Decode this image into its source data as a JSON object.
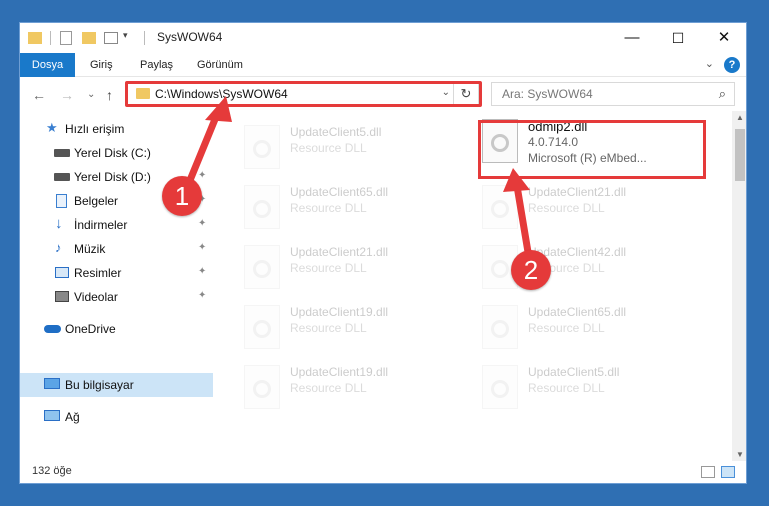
{
  "window": {
    "title": "SysWOW64",
    "controls": {
      "minimize": "—",
      "maximize": "☐",
      "close": "✕"
    }
  },
  "ribbon": {
    "tabs": [
      "Dosya",
      "Giriş",
      "Paylaş",
      "Görünüm"
    ],
    "help": "?",
    "collapse": "⌄"
  },
  "nav": {
    "back": "←",
    "forward": "→",
    "recent": "⌄",
    "up": "↑",
    "address": "C:\\Windows\\SysWOW64",
    "search_placeholder": "Ara: SysWOW64",
    "refresh": "↻"
  },
  "sidebar": {
    "items": [
      {
        "label": "Hızlı erişim",
        "icon": "star-icon",
        "pinned": false
      },
      {
        "label": "Yerel Disk (C:)",
        "icon": "drive-icon",
        "pinned": false
      },
      {
        "label": "Yerel Disk (D:)",
        "icon": "drive-icon",
        "pinned": true
      },
      {
        "label": "Belgeler",
        "icon": "documents-icon",
        "pinned": true
      },
      {
        "label": "İndirmeler",
        "icon": "download-icon",
        "pinned": true
      },
      {
        "label": "Müzik",
        "icon": "music-icon",
        "pinned": true
      },
      {
        "label": "Resimler",
        "icon": "pictures-icon",
        "pinned": true
      },
      {
        "label": "Videolar",
        "icon": "videos-icon",
        "pinned": true
      },
      {
        "label": "OneDrive",
        "icon": "cloud-icon",
        "pinned": false
      },
      {
        "label": "Bu bilgisayar",
        "icon": "computer-icon",
        "pinned": false,
        "selected": true
      },
      {
        "label": "Ağ",
        "icon": "network-icon",
        "pinned": false
      }
    ],
    "pin_glyph": "📌"
  },
  "files": {
    "left": [
      {
        "name": "UpdateClient5.dll",
        "type": "Resource DLL"
      },
      {
        "name": "UpdateClient65.dll",
        "type": "Resource DLL"
      },
      {
        "name": "UpdateClient21.dll",
        "type": "Resource DLL"
      },
      {
        "name": "UpdateClient19.dll",
        "type": "Resource DLL"
      },
      {
        "name": "UpdateClient19.dll",
        "type": "Resource DLL"
      }
    ],
    "right": [
      {
        "name": "UpdateClient21.dll",
        "type": "Resource DLL"
      },
      {
        "name": "UpdateClient42.dll",
        "type": "Resource DLL"
      },
      {
        "name": "UpdateClient65.dll",
        "type": "Resource DLL"
      },
      {
        "name": "UpdateClient5.dll",
        "type": "Resource DLL"
      }
    ],
    "highlighted": {
      "name": "odmip2.dll",
      "version": "4.0.714.0",
      "description": "Microsoft (R) eMbed..."
    }
  },
  "annotations": {
    "step1": "1",
    "step2": "2",
    "highlight_color": "#e53a3a"
  },
  "status": {
    "count": "132 öğe"
  },
  "colors": {
    "accent": "#1979ca",
    "selection": "#cce4f7",
    "desktop": "#2f6fb3"
  }
}
